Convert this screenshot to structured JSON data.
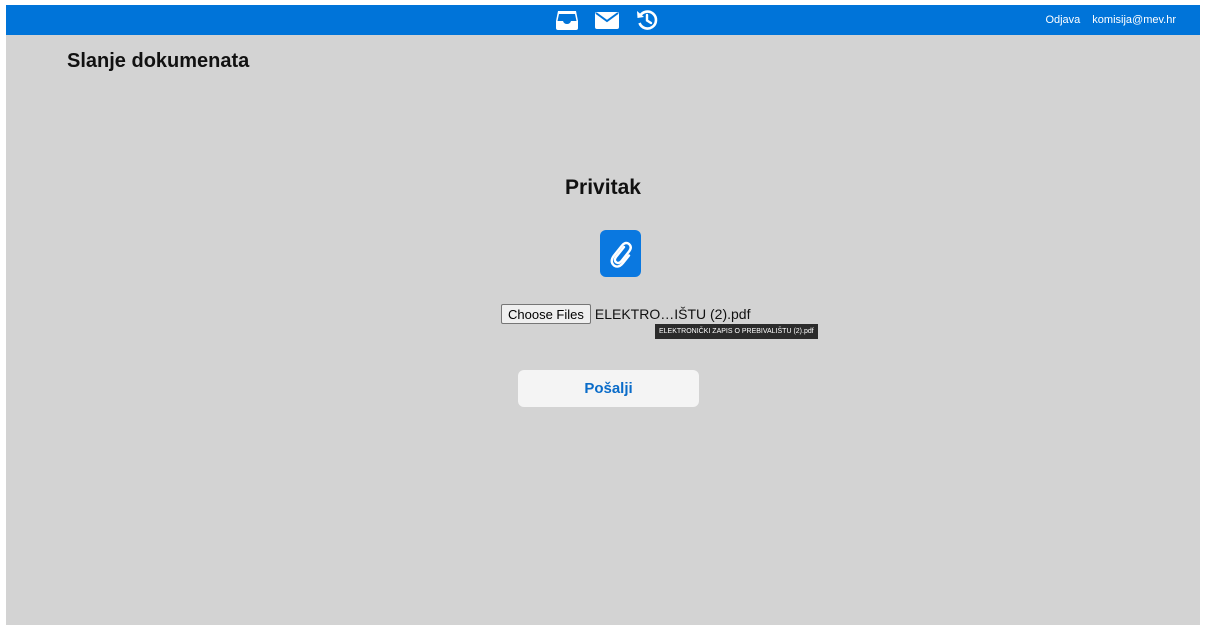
{
  "topbar": {
    "icons": [
      "inbox-icon",
      "envelope-icon",
      "history-icon"
    ],
    "logout_label": "Odjava",
    "user_email": "komisija@mev.hr"
  },
  "page": {
    "title": "Slanje dokumenata"
  },
  "attachment": {
    "title": "Privitak",
    "icon": "paperclip-icon",
    "choose_label": "Choose Files",
    "file_name_display": "ELEKTRO…IŠTU (2).pdf",
    "file_name_full": "ELEKTRONIČKI ZAPIS O PREBIVALIŠTU (2).pdf"
  },
  "actions": {
    "send_label": "Pošalji"
  },
  "colors": {
    "accent": "#0074d9",
    "background": "#d3d3d3",
    "button_text": "#0a6cc9"
  }
}
